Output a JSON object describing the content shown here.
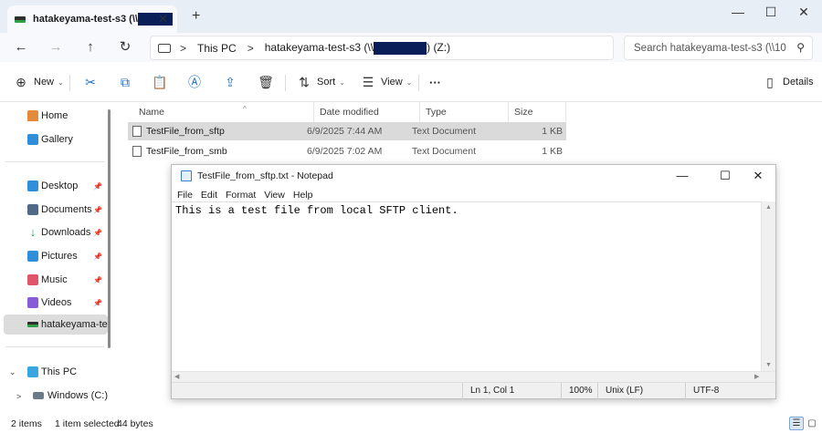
{
  "window": {
    "tab_title": "hatakeyama-test-s3 (\\\\",
    "tab_close": "✕",
    "new_tab": "+",
    "minimize": "—",
    "maximize": "☐",
    "close": "✕"
  },
  "nav": {
    "back_icon": "←",
    "forward_icon": "→",
    "up_icon": "↑",
    "refresh_icon": "↻",
    "breadcrumb": {
      "chevron": ">",
      "this_pc": "This PC",
      "drive_prefix": "hatakeyama-test-s3 (\\\\",
      "drive_suffix": ") (Z:)"
    },
    "search_placeholder": "Search hatakeyama-test-s3 (\\\\10",
    "search_icon": "⚲"
  },
  "toolbar": {
    "new_label": "New",
    "sort_label": "Sort",
    "view_label": "View",
    "more": "···",
    "details_label": "Details",
    "caret": "⌄"
  },
  "sidebar": {
    "home": "Home",
    "gallery": "Gallery",
    "desktop": "Desktop",
    "documents": "Documents",
    "downloads": "Downloads",
    "pictures": "Pictures",
    "music": "Music",
    "videos": "Videos",
    "network_drive": "hatakeyama-tes",
    "this_pc": "This PC",
    "windows_c": "Windows (C:)",
    "pin": "📌",
    "expander_open": "⌄",
    "expander_closed": ">"
  },
  "columns": {
    "name": "Name",
    "date_modified": "Date modified",
    "type": "Type",
    "size": "Size",
    "sort_caret": "^"
  },
  "files": [
    {
      "name": "TestFile_from_sftp",
      "date": "6/9/2025 7:44 AM",
      "type": "Text Document",
      "size": "1 KB",
      "selected": true
    },
    {
      "name": "TestFile_from_smb",
      "date": "6/9/2025 7:02 AM",
      "type": "Text Document",
      "size": "1 KB",
      "selected": false
    }
  ],
  "status": {
    "items": "2 items",
    "selected": "1 item selected",
    "size": "44 bytes"
  },
  "notepad": {
    "title": "TestFile_from_sftp.txt - Notepad",
    "minimize": "—",
    "maximize": "☐",
    "close": "✕",
    "menu": [
      "File",
      "Edit",
      "Format",
      "View",
      "Help"
    ],
    "content": "This is a test file from local SFTP client.",
    "status": {
      "position": "Ln 1, Col 1",
      "zoom": "100%",
      "line_endings": "Unix (LF)",
      "encoding": "UTF-8"
    }
  },
  "colors": {
    "accent": "#1a6fc4",
    "redaction": "#0a1e5a",
    "drive_green": "#2ea043"
  }
}
